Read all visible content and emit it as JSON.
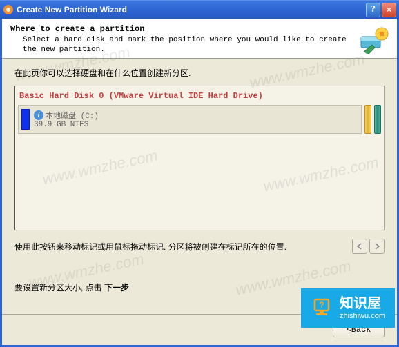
{
  "titlebar": {
    "title": "Create New Partition Wizard",
    "help_label": "?",
    "close_label": "×"
  },
  "header": {
    "title": "Where to create a partition",
    "subtitle": "Select a hard disk and mark the position where you would like to create the new partition."
  },
  "instruction": "在此页你可以选择硬盘和在什么位置创建新分区.",
  "disk": {
    "header": "Basic Hard Disk 0 (VMware Virtual IDE Hard Drive)",
    "partition": {
      "name": "本地磁盘 (C:)",
      "info": "39.9 GB NTFS"
    }
  },
  "hint": "使用此按钮来移动标记或用鼠标拖动标记. 分区将被创建在标记所在的位置.",
  "next_hint_prefix": "要设置新分区大小, 点击 ",
  "next_hint_bold": "下一步",
  "buttons": {
    "back": "Back",
    "back_prefix": "< "
  },
  "watermark": {
    "text": "www.wmzhe.com",
    "brand_name": "知识屋",
    "brand_url": "zhishiwu.com"
  }
}
